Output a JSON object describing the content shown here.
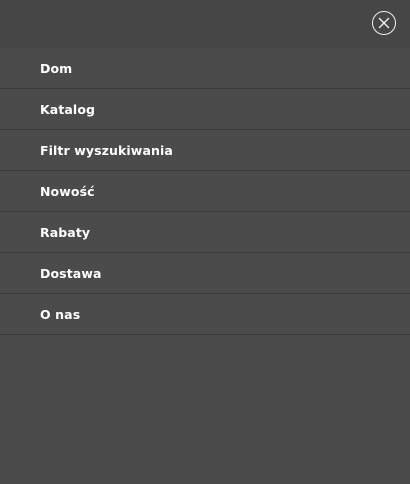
{
  "header": {
    "close_icon": "close-circle-icon"
  },
  "menu": {
    "items": [
      {
        "label": "Dom"
      },
      {
        "label": "Katalog"
      },
      {
        "label": "Filtr wyszukiwania"
      },
      {
        "label": "Nowość"
      },
      {
        "label": "Rabaty"
      },
      {
        "label": "Dostawa"
      },
      {
        "label": "O nas"
      }
    ]
  },
  "colors": {
    "background": "#4b4b4b",
    "header_background": "#464646",
    "divider": "#3a3a3a",
    "text": "#ffffff"
  }
}
